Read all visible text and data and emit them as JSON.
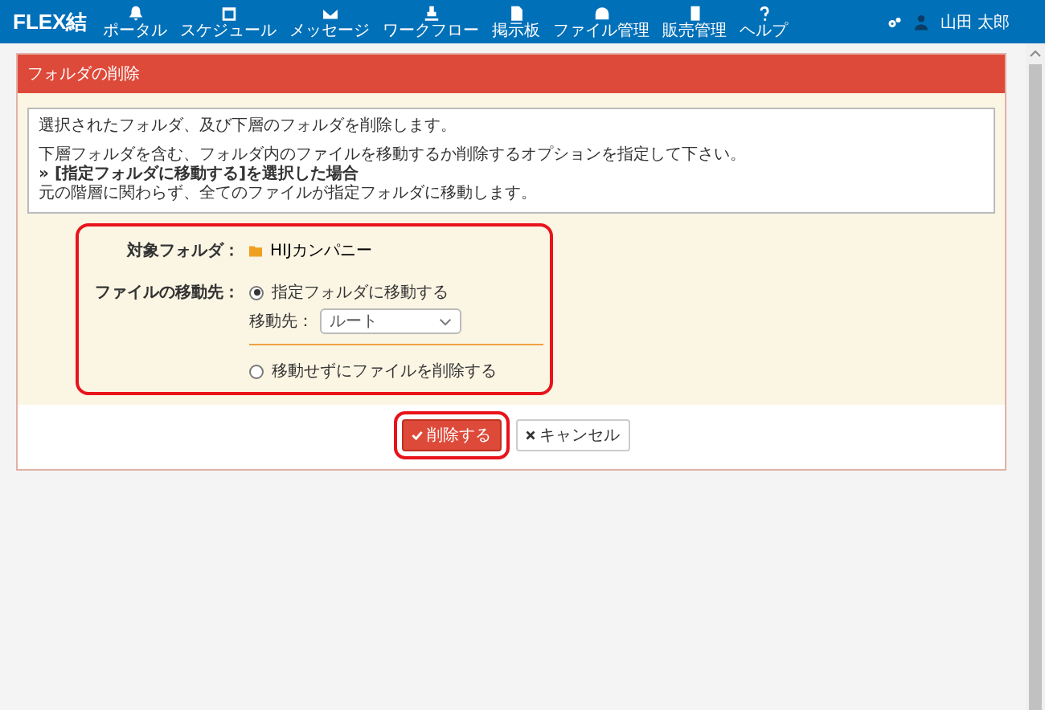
{
  "header": {
    "logo": "FLEX結",
    "nav": [
      {
        "label": "ポータル"
      },
      {
        "label": "スケジュール"
      },
      {
        "label": "メッセージ"
      },
      {
        "label": "ワークフロー"
      },
      {
        "label": "掲示板"
      },
      {
        "label": "ファイル管理"
      },
      {
        "label": "販売管理"
      },
      {
        "label": "ヘルプ"
      }
    ],
    "user": "山田 太郎"
  },
  "panel": {
    "title": "フォルダの削除",
    "info": [
      "選択されたフォルダ、及び下層のフォルダを削除します。",
      "下層フォルダを含む、フォルダ内のファイルを移動するか削除するオプションを指定して下さい。",
      "» [指定フォルダに移動する]を選択した場合",
      "元の階層に関わらず、全てのファイルが指定フォルダに移動します。"
    ],
    "target_label": "対象フォルダ：",
    "target_folder": "HIJカンパニー",
    "move_label": "ファイルの移動先：",
    "options": [
      {
        "label": "指定フォルダに移動する",
        "selected": true
      },
      {
        "label": "移動せずにファイルを削除する",
        "selected": false
      }
    ],
    "dest_label": "移動先：",
    "dest_value": "ルート",
    "delete_button": "削除する",
    "cancel_button": "キャンセル"
  }
}
